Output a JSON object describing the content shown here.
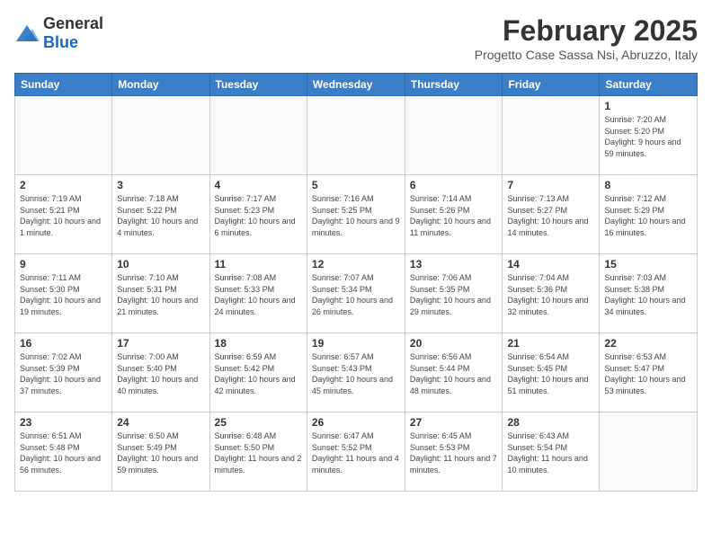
{
  "logo": {
    "general": "General",
    "blue": "Blue"
  },
  "header": {
    "month": "February 2025",
    "location": "Progetto Case Sassa Nsi, Abruzzo, Italy"
  },
  "weekdays": [
    "Sunday",
    "Monday",
    "Tuesday",
    "Wednesday",
    "Thursday",
    "Friday",
    "Saturday"
  ],
  "weeks": [
    [
      {
        "day": "",
        "info": ""
      },
      {
        "day": "",
        "info": ""
      },
      {
        "day": "",
        "info": ""
      },
      {
        "day": "",
        "info": ""
      },
      {
        "day": "",
        "info": ""
      },
      {
        "day": "",
        "info": ""
      },
      {
        "day": "1",
        "info": "Sunrise: 7:20 AM\nSunset: 5:20 PM\nDaylight: 9 hours and 59 minutes."
      }
    ],
    [
      {
        "day": "2",
        "info": "Sunrise: 7:19 AM\nSunset: 5:21 PM\nDaylight: 10 hours and 1 minute."
      },
      {
        "day": "3",
        "info": "Sunrise: 7:18 AM\nSunset: 5:22 PM\nDaylight: 10 hours and 4 minutes."
      },
      {
        "day": "4",
        "info": "Sunrise: 7:17 AM\nSunset: 5:23 PM\nDaylight: 10 hours and 6 minutes."
      },
      {
        "day": "5",
        "info": "Sunrise: 7:16 AM\nSunset: 5:25 PM\nDaylight: 10 hours and 9 minutes."
      },
      {
        "day": "6",
        "info": "Sunrise: 7:14 AM\nSunset: 5:26 PM\nDaylight: 10 hours and 11 minutes."
      },
      {
        "day": "7",
        "info": "Sunrise: 7:13 AM\nSunset: 5:27 PM\nDaylight: 10 hours and 14 minutes."
      },
      {
        "day": "8",
        "info": "Sunrise: 7:12 AM\nSunset: 5:29 PM\nDaylight: 10 hours and 16 minutes."
      }
    ],
    [
      {
        "day": "9",
        "info": "Sunrise: 7:11 AM\nSunset: 5:30 PM\nDaylight: 10 hours and 19 minutes."
      },
      {
        "day": "10",
        "info": "Sunrise: 7:10 AM\nSunset: 5:31 PM\nDaylight: 10 hours and 21 minutes."
      },
      {
        "day": "11",
        "info": "Sunrise: 7:08 AM\nSunset: 5:33 PM\nDaylight: 10 hours and 24 minutes."
      },
      {
        "day": "12",
        "info": "Sunrise: 7:07 AM\nSunset: 5:34 PM\nDaylight: 10 hours and 26 minutes."
      },
      {
        "day": "13",
        "info": "Sunrise: 7:06 AM\nSunset: 5:35 PM\nDaylight: 10 hours and 29 minutes."
      },
      {
        "day": "14",
        "info": "Sunrise: 7:04 AM\nSunset: 5:36 PM\nDaylight: 10 hours and 32 minutes."
      },
      {
        "day": "15",
        "info": "Sunrise: 7:03 AM\nSunset: 5:38 PM\nDaylight: 10 hours and 34 minutes."
      }
    ],
    [
      {
        "day": "16",
        "info": "Sunrise: 7:02 AM\nSunset: 5:39 PM\nDaylight: 10 hours and 37 minutes."
      },
      {
        "day": "17",
        "info": "Sunrise: 7:00 AM\nSunset: 5:40 PM\nDaylight: 10 hours and 40 minutes."
      },
      {
        "day": "18",
        "info": "Sunrise: 6:59 AM\nSunset: 5:42 PM\nDaylight: 10 hours and 42 minutes."
      },
      {
        "day": "19",
        "info": "Sunrise: 6:57 AM\nSunset: 5:43 PM\nDaylight: 10 hours and 45 minutes."
      },
      {
        "day": "20",
        "info": "Sunrise: 6:56 AM\nSunset: 5:44 PM\nDaylight: 10 hours and 48 minutes."
      },
      {
        "day": "21",
        "info": "Sunrise: 6:54 AM\nSunset: 5:45 PM\nDaylight: 10 hours and 51 minutes."
      },
      {
        "day": "22",
        "info": "Sunrise: 6:53 AM\nSunset: 5:47 PM\nDaylight: 10 hours and 53 minutes."
      }
    ],
    [
      {
        "day": "23",
        "info": "Sunrise: 6:51 AM\nSunset: 5:48 PM\nDaylight: 10 hours and 56 minutes."
      },
      {
        "day": "24",
        "info": "Sunrise: 6:50 AM\nSunset: 5:49 PM\nDaylight: 10 hours and 59 minutes."
      },
      {
        "day": "25",
        "info": "Sunrise: 6:48 AM\nSunset: 5:50 PM\nDaylight: 11 hours and 2 minutes."
      },
      {
        "day": "26",
        "info": "Sunrise: 6:47 AM\nSunset: 5:52 PM\nDaylight: 11 hours and 4 minutes."
      },
      {
        "day": "27",
        "info": "Sunrise: 6:45 AM\nSunset: 5:53 PM\nDaylight: 11 hours and 7 minutes."
      },
      {
        "day": "28",
        "info": "Sunrise: 6:43 AM\nSunset: 5:54 PM\nDaylight: 11 hours and 10 minutes."
      },
      {
        "day": "",
        "info": ""
      }
    ]
  ]
}
